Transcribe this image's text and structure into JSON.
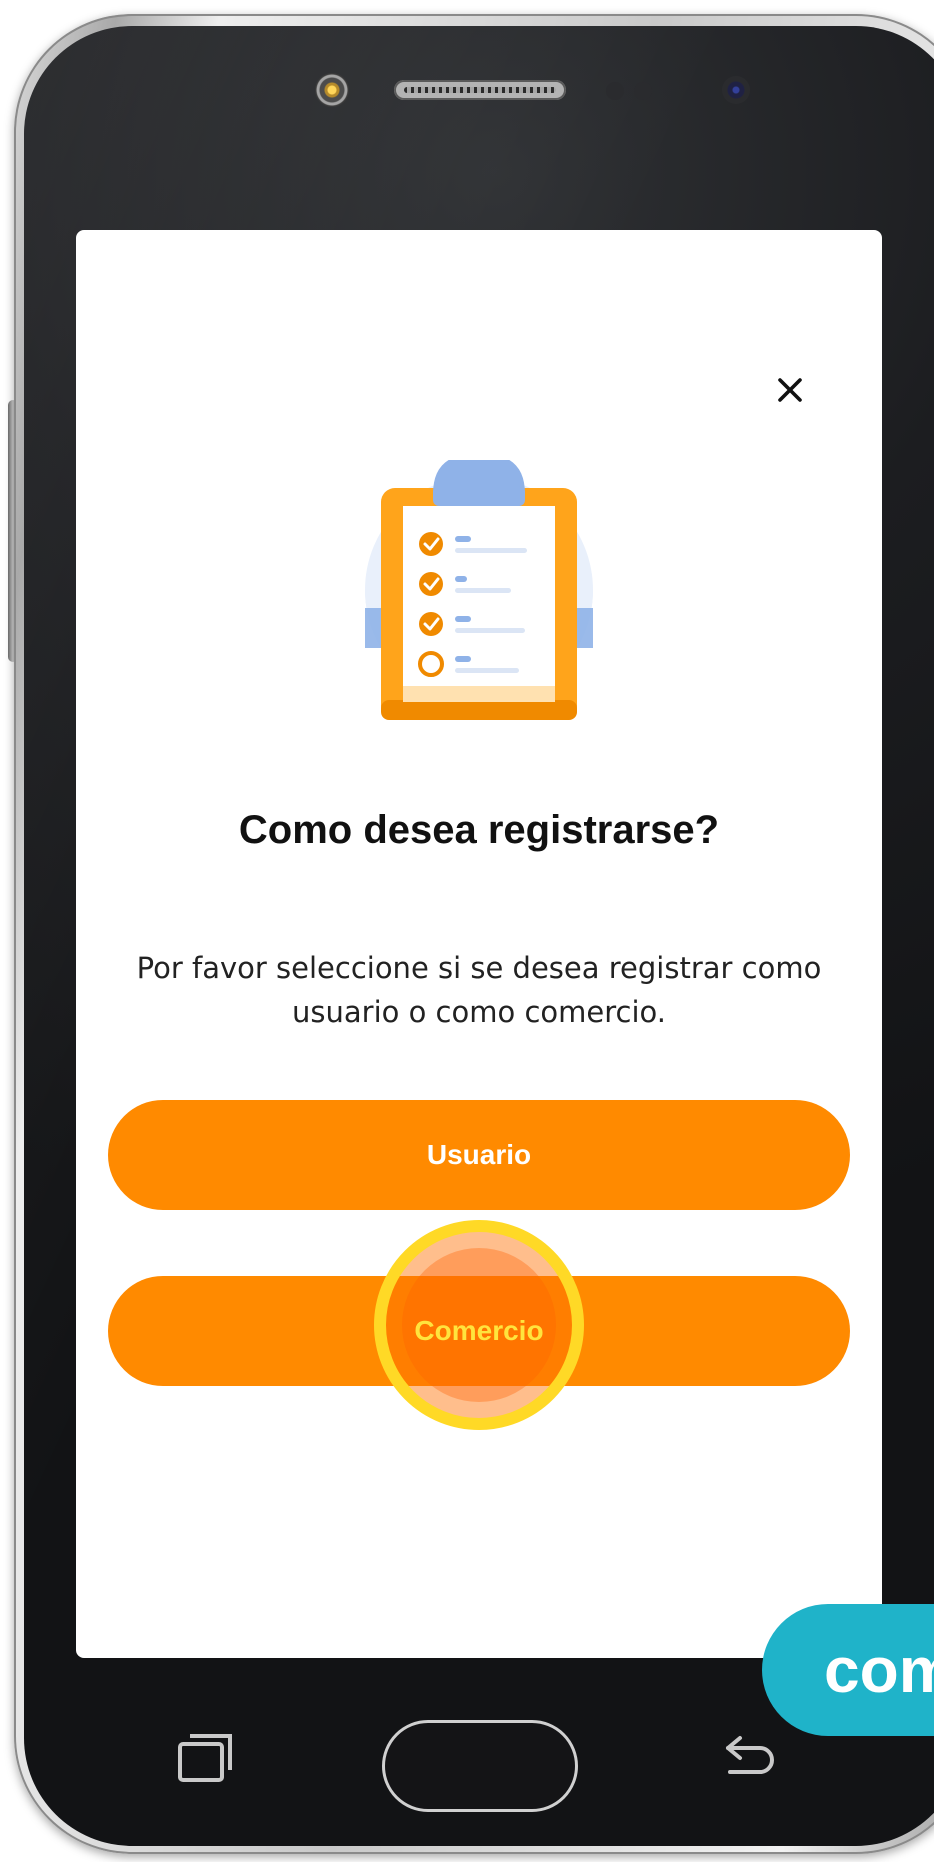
{
  "dialog": {
    "close_glyph": "×",
    "title": "Como desea registrarse?",
    "description": "Por favor seleccione si se desea registrar como usuario o como comercio.",
    "illustration_icon": "checklist-clipboard-icon"
  },
  "options": [
    {
      "label": "Usuario"
    },
    {
      "label": "Comercio"
    }
  ],
  "overlay": {
    "badge_text": "com"
  },
  "colors": {
    "button": "#ff8a00",
    "tap_ring": "#ffd926",
    "badge": "#1fb3c9",
    "clipboard": "#ffa41b",
    "accent_blue": "#8fb2e8"
  },
  "phone_keys": [
    "recents-key-icon",
    "home-key",
    "back-key-icon"
  ]
}
